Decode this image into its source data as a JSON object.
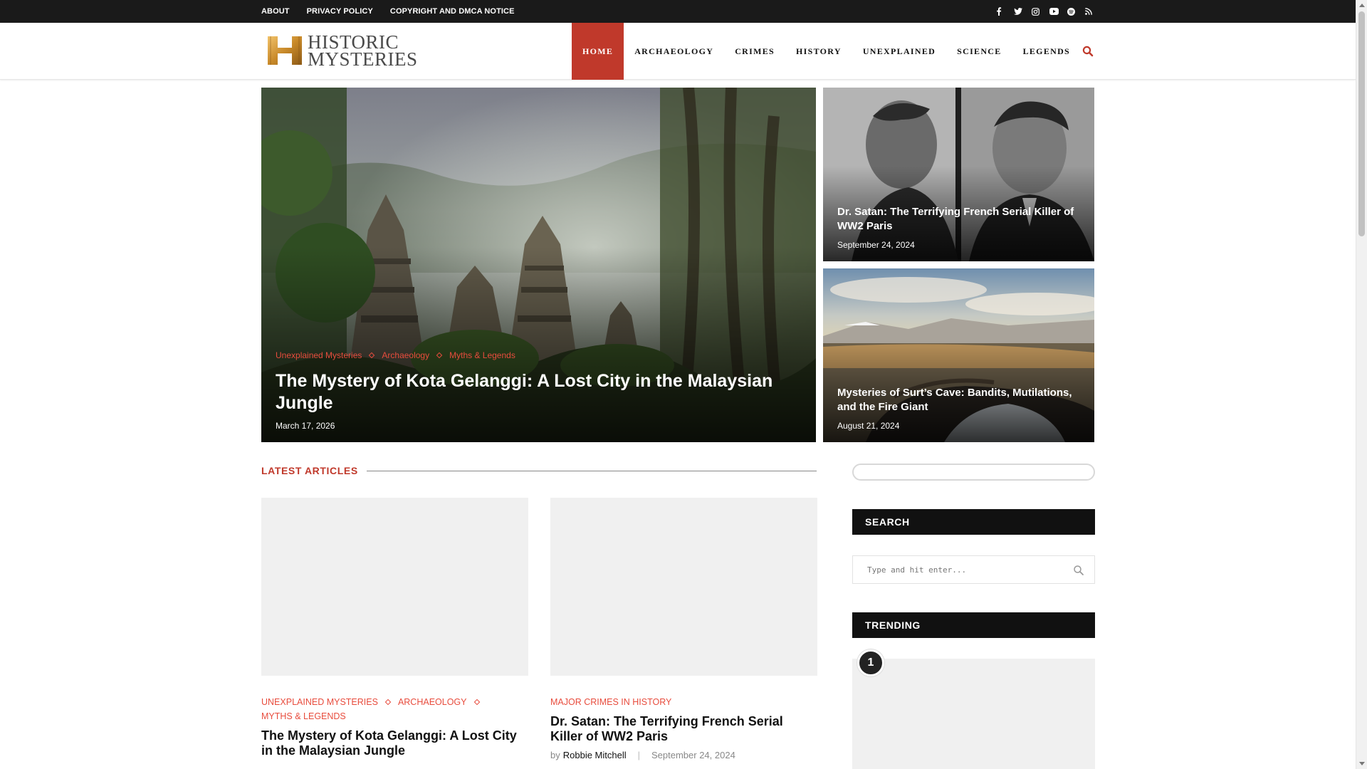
{
  "topbar": {
    "links": [
      "ABOUT",
      "PRIVACY POLICY",
      "COPYRIGHT AND DMCA NOTICE"
    ],
    "social_icons": [
      "facebook-icon",
      "twitter-icon",
      "instagram-icon",
      "youtube-icon",
      "spotify-icon",
      "rss-icon"
    ]
  },
  "header": {
    "logo": {
      "line1": "HISTORIC",
      "line2": "MYSTERIES"
    },
    "nav": [
      "HOME",
      "ARCHAEOLOGY",
      "CRIMES",
      "HISTORY",
      "UNEXPLAINED",
      "SCIENCE",
      "LEGENDS"
    ],
    "active_nav": "HOME"
  },
  "hero": {
    "main": {
      "categories": [
        "Unexplained Mysteries",
        "Archaeology",
        "Myths & Legends"
      ],
      "title": "The Mystery of Kota Gelanggi: A Lost City in the Malaysian Jungle",
      "date": "March 17, 2026"
    },
    "side": [
      {
        "title": "Dr. Satan: The Terrifying French Serial Killer of WW2 Paris",
        "date": "September 24, 2024"
      },
      {
        "title": "Mysteries of Surt’s Cave: Bandits, Mutilations, and the Fire Giant",
        "date": "August 21, 2024"
      }
    ]
  },
  "latest": {
    "heading": "LATEST ARTICLES",
    "articles": [
      {
        "categories": [
          "UNEXPLAINED MYSTERIES",
          "ARCHAEOLOGY",
          "MYTHS & LEGENDS"
        ],
        "title": "The Mystery of Kota Gelanggi: A Lost City in the Malaysian Jungle"
      },
      {
        "categories": [
          "MAJOR CRIMES IN HISTORY"
        ],
        "title": "Dr. Satan: The Terrifying French Serial Killer of WW2 Paris",
        "by": "by",
        "author": "Robbie Mitchell",
        "sep": "|",
        "date": "September 24, 2024"
      }
    ]
  },
  "sidebar": {
    "search_heading": "SEARCH",
    "search_placeholder": "Type and hit enter...",
    "trending_heading": "TRENDING",
    "trending_number": "1"
  },
  "colors": {
    "accent": "#c0392b",
    "category": "#e84c3d",
    "topbar": "#1a1a1a"
  }
}
